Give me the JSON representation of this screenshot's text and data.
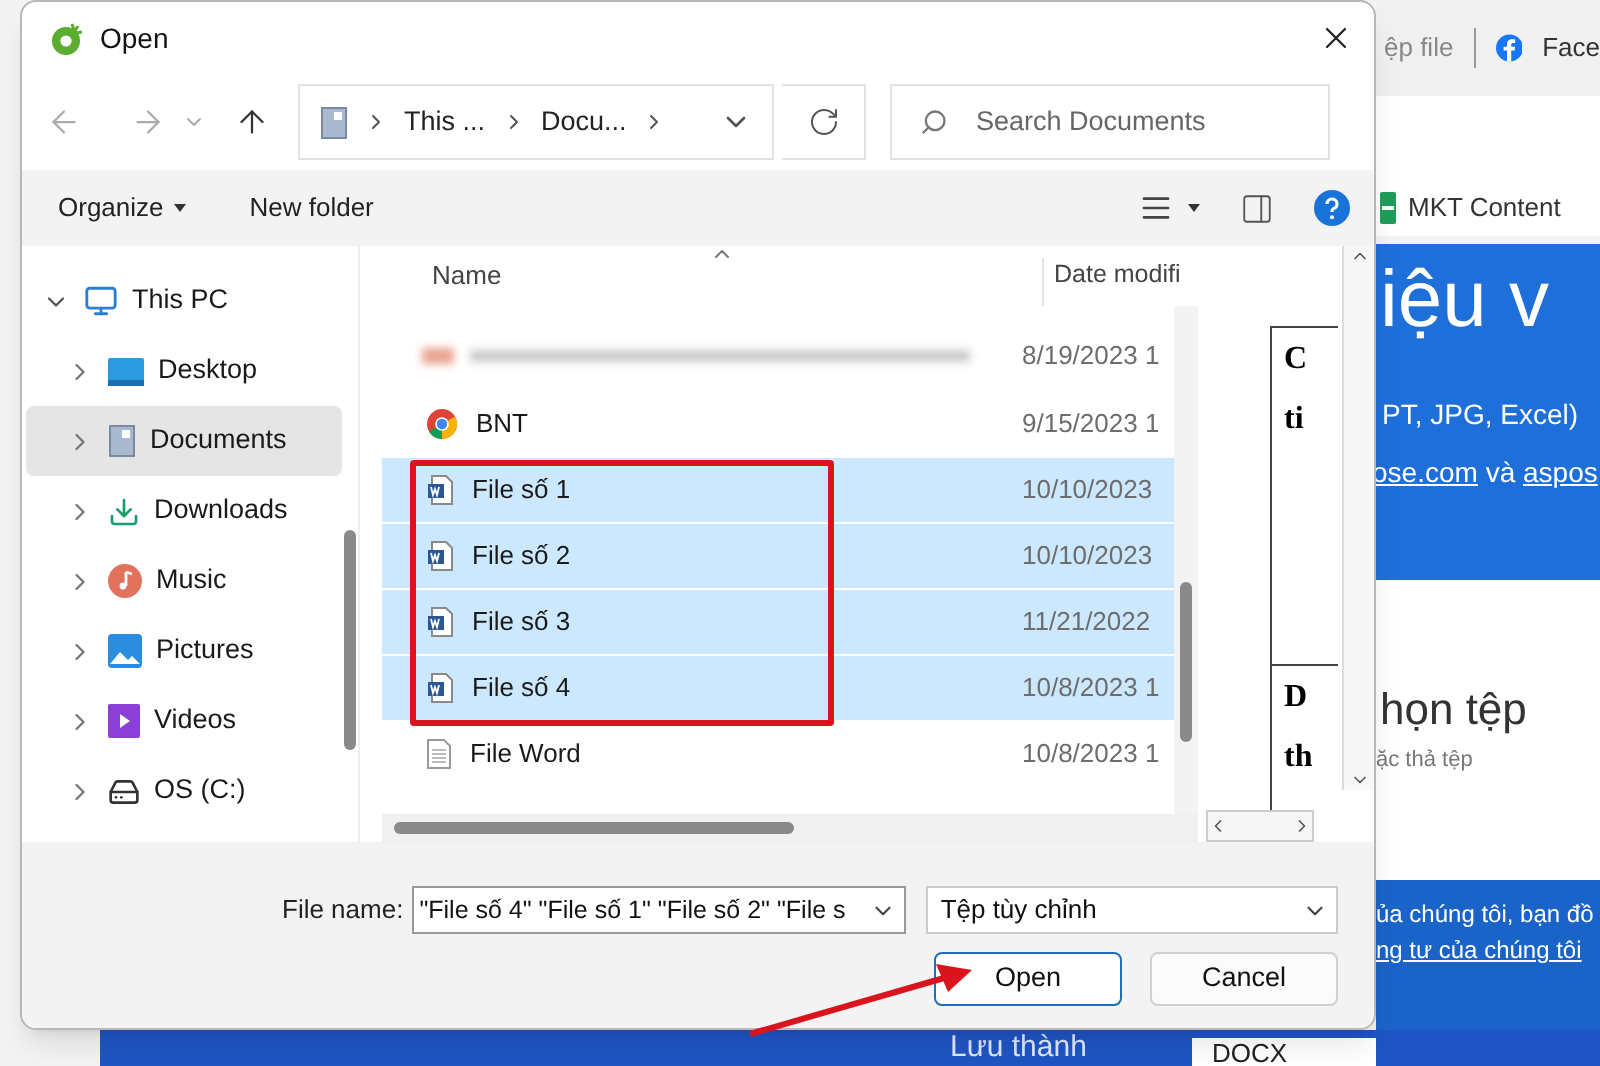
{
  "window": {
    "title": "Open"
  },
  "address": {
    "segments": [
      "This ...",
      "Docu..."
    ]
  },
  "search": {
    "placeholder": "Search Documents"
  },
  "toolbar": {
    "organize": "Organize",
    "new_folder": "New folder"
  },
  "sidebar": {
    "items": [
      {
        "label": "This PC",
        "expanded": true,
        "selected": false,
        "children": [
          {
            "label": "Desktop",
            "expanded": false,
            "selected": false
          },
          {
            "label": "Documents",
            "expanded": false,
            "selected": true
          },
          {
            "label": "Downloads",
            "expanded": false,
            "selected": false
          },
          {
            "label": "Music",
            "expanded": false,
            "selected": false
          },
          {
            "label": "Pictures",
            "expanded": false,
            "selected": false
          },
          {
            "label": "Videos",
            "expanded": false,
            "selected": false
          },
          {
            "label": "OS (C:)",
            "expanded": false,
            "selected": false
          }
        ]
      }
    ]
  },
  "table": {
    "columns": [
      "Name",
      "Date modifi"
    ],
    "rows": [
      {
        "kind": "blurred",
        "date": "8/19/2023 1",
        "selected": false
      },
      {
        "kind": "chrome",
        "name": "BNT",
        "date": "9/15/2023 1",
        "selected": false
      },
      {
        "kind": "word",
        "name": "File số 1",
        "date": "10/10/2023",
        "selected": true
      },
      {
        "kind": "word",
        "name": "File số 2",
        "date": "10/10/2023",
        "selected": true
      },
      {
        "kind": "word",
        "name": "File số 3",
        "date": "11/21/2022",
        "selected": true
      },
      {
        "kind": "word",
        "name": "File số 4",
        "date": "10/8/2023 1",
        "selected": true
      },
      {
        "kind": "doc",
        "name": "File Word",
        "date": "10/8/2023 1",
        "selected": false
      }
    ]
  },
  "preview": {
    "texts": [
      "C",
      "ti",
      "D",
      "th"
    ]
  },
  "file_name": {
    "label": "File name:",
    "value": "\"File số 4\" \"File số 1\" \"File số 2\" \"File s"
  },
  "file_type": {
    "value": "Tệp tùy chỉnh"
  },
  "buttons": [
    {
      "label": "Open",
      "kind": "primary"
    },
    {
      "label": "Cancel",
      "kind": "normal"
    }
  ],
  "background": {
    "tabs": [
      "ệp file",
      "Face"
    ],
    "bookmark": "MKT Content",
    "banner_title": "iệu v",
    "banner_sub": "PT, JPG, Excel)",
    "banner_links": [
      "ose.com",
      "và",
      "aspos"
    ],
    "section_title": "họn tệp",
    "section_sub": "ặc thả tệp",
    "notice": [
      "ủa chúng tôi, bạn đồ",
      "ng tư của chúng tôi"
    ],
    "footer_label": "Lưu thành",
    "footer_format": "DOCX"
  }
}
